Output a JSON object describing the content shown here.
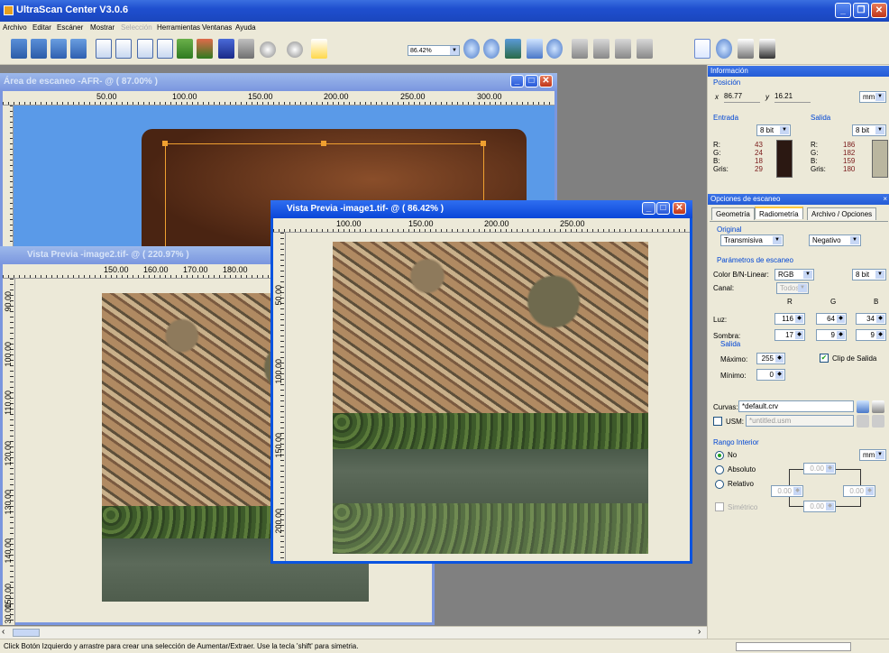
{
  "app": {
    "title": "UltraScan Center  V3.0.6"
  },
  "menu": [
    "Archivo",
    "Editar",
    "Escáner",
    "Mostrar",
    "Selección",
    "Herramientas",
    "Ventanas",
    "Ayuda"
  ],
  "toolbar": {
    "zoom_value": "86.42%"
  },
  "windows": {
    "scan_area": {
      "title": "Área de escaneo -AFR- @ ( 87.00% )",
      "ruler_h": [
        "50.00",
        "100.00",
        "150.00",
        "200.00",
        "250.00",
        "300.00"
      ]
    },
    "preview2": {
      "title": "Vista Previa -image2.tif- @ ( 220.97% )",
      "ruler_h": [
        "150.00",
        "160.00",
        "170.00",
        "180.00"
      ],
      "ruler_v": [
        "90.00",
        "100.00",
        "110.00",
        "120.00",
        "130.00",
        "140.00",
        "150.00",
        "30.00"
      ]
    },
    "preview1": {
      "title": "Vista Previa -image1.tif- @ ( 86.42% )",
      "ruler_h": [
        "100.00",
        "150.00",
        "200.00",
        "250.00"
      ],
      "ruler_v": [
        "50.00",
        "100.00",
        "150.00",
        "200.00"
      ]
    }
  },
  "info": {
    "header": "Información",
    "position_label": "Posición",
    "x_label": "x",
    "x_value": "86.77",
    "y_label": "y",
    "y_value": "16.21",
    "unit": "mm",
    "input": {
      "label": "Entrada",
      "bits": "8 bit",
      "r": "43",
      "g": "24",
      "b": "18",
      "gris": "29",
      "color": "#2b1812"
    },
    "output": {
      "label": "Salida",
      "bits": "8 bit",
      "r": "186",
      "g": "182",
      "b": "159",
      "gris": "180",
      "color": "#bab69f"
    },
    "r_label": "R:",
    "g_label": "G:",
    "b_label": "B:",
    "gris_label": "Gris:"
  },
  "scan_options": {
    "header": "Opciones de escaneo",
    "tabs": [
      "Geometría",
      "Radiometría",
      "Archivo / Opciones"
    ],
    "original_label": "Original",
    "original_mode": "Transmisiva",
    "original_polarity": "Negativo",
    "params_label": "Parámetros de escaneo",
    "color_label": "Color B/N-Linear:",
    "color_value": "RGB",
    "bits_value": "8 bit",
    "channel_label": "Canal:",
    "channel_value": "Todos",
    "col_r": "R",
    "col_g": "G",
    "col_b": "B",
    "luz_label": "Luz:",
    "luz": [
      "116",
      "64",
      "34"
    ],
    "sombra_label": "Sombra:",
    "sombra": [
      "17",
      "9",
      "9"
    ],
    "salida_label": "Salida",
    "max_label": "Máximo:",
    "max_value": "255",
    "min_label": "Mínimo:",
    "min_value": "0",
    "clip_label": "Clip de Salida",
    "curves_label": "Curvas:",
    "curves_value": "*default.crv",
    "usm_label": "USM:",
    "usm_value": "*untitled.usm",
    "range_label": "Rango Interior",
    "range_unit": "mm",
    "radio_no": "No",
    "radio_abs": "Absoluto",
    "radio_rel": "Relativo",
    "sym_label": "Simétrico",
    "zero": "0.00"
  },
  "status": {
    "text": "Click Botón Izquierdo y arrastre para crear una selección de Aumentar/Extraer. Use la tecla 'shift' para simetria."
  }
}
